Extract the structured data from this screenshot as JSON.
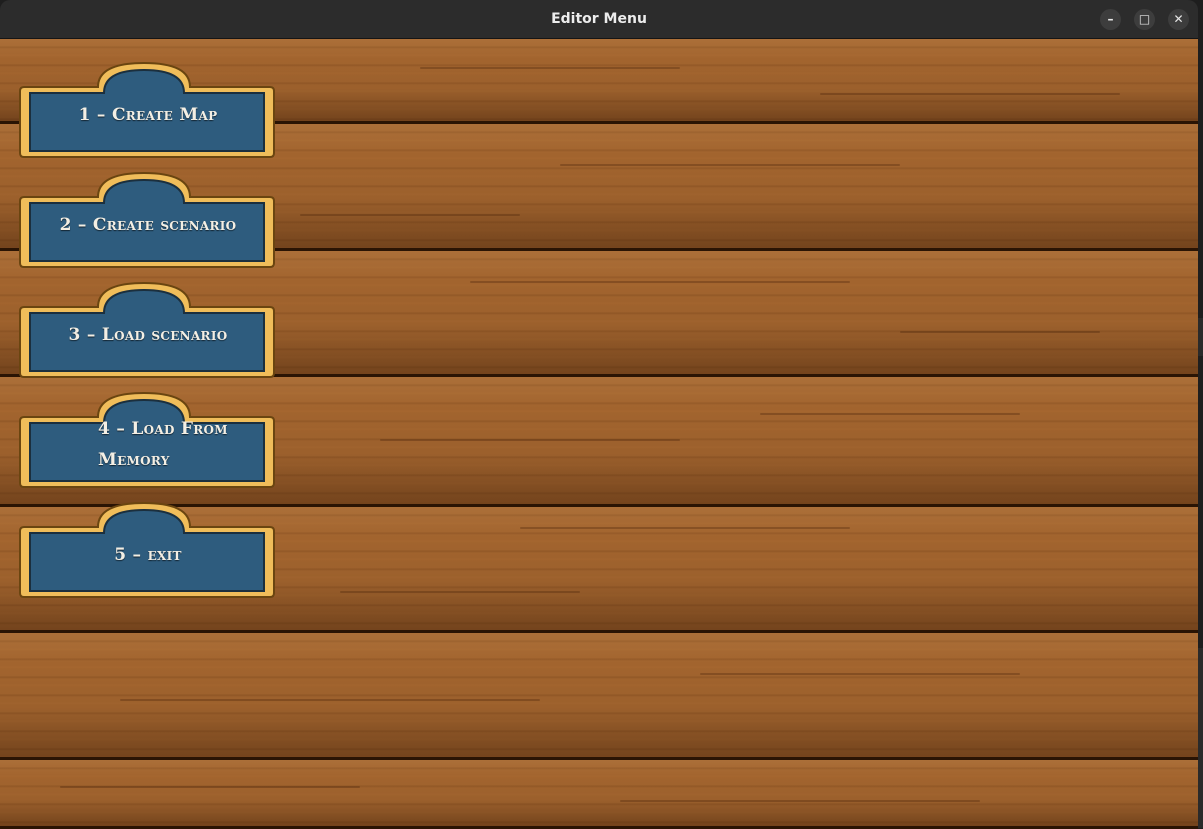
{
  "window": {
    "title": "Editor Menu",
    "controls": {
      "minimize": "–",
      "maximize": "□",
      "close": "✕"
    }
  },
  "menu": {
    "buttons": [
      {
        "label": "1 – Create Map"
      },
      {
        "label": "2 – Create scenario"
      },
      {
        "label": "3 – Load scenario"
      },
      {
        "label": "4 – Load From Memory"
      },
      {
        "label": "5 – exit"
      }
    ]
  },
  "colors": {
    "button_fill": "#2e5c7e",
    "button_border": "#f0bd5a",
    "wood": "#a2642e"
  }
}
